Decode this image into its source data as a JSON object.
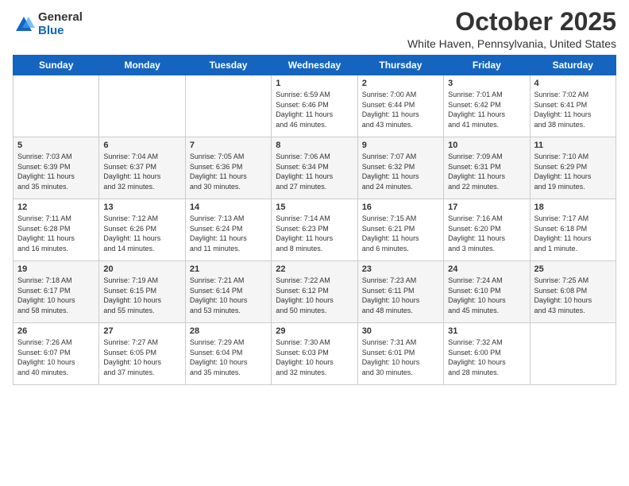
{
  "logo": {
    "general": "General",
    "blue": "Blue"
  },
  "header": {
    "month": "October 2025",
    "location": "White Haven, Pennsylvania, United States"
  },
  "weekdays": [
    "Sunday",
    "Monday",
    "Tuesday",
    "Wednesday",
    "Thursday",
    "Friday",
    "Saturday"
  ],
  "weeks": [
    [
      {
        "day": "",
        "info": ""
      },
      {
        "day": "",
        "info": ""
      },
      {
        "day": "",
        "info": ""
      },
      {
        "day": "1",
        "info": "Sunrise: 6:59 AM\nSunset: 6:46 PM\nDaylight: 11 hours\nand 46 minutes."
      },
      {
        "day": "2",
        "info": "Sunrise: 7:00 AM\nSunset: 6:44 PM\nDaylight: 11 hours\nand 43 minutes."
      },
      {
        "day": "3",
        "info": "Sunrise: 7:01 AM\nSunset: 6:42 PM\nDaylight: 11 hours\nand 41 minutes."
      },
      {
        "day": "4",
        "info": "Sunrise: 7:02 AM\nSunset: 6:41 PM\nDaylight: 11 hours\nand 38 minutes."
      }
    ],
    [
      {
        "day": "5",
        "info": "Sunrise: 7:03 AM\nSunset: 6:39 PM\nDaylight: 11 hours\nand 35 minutes."
      },
      {
        "day": "6",
        "info": "Sunrise: 7:04 AM\nSunset: 6:37 PM\nDaylight: 11 hours\nand 32 minutes."
      },
      {
        "day": "7",
        "info": "Sunrise: 7:05 AM\nSunset: 6:36 PM\nDaylight: 11 hours\nand 30 minutes."
      },
      {
        "day": "8",
        "info": "Sunrise: 7:06 AM\nSunset: 6:34 PM\nDaylight: 11 hours\nand 27 minutes."
      },
      {
        "day": "9",
        "info": "Sunrise: 7:07 AM\nSunset: 6:32 PM\nDaylight: 11 hours\nand 24 minutes."
      },
      {
        "day": "10",
        "info": "Sunrise: 7:09 AM\nSunset: 6:31 PM\nDaylight: 11 hours\nand 22 minutes."
      },
      {
        "day": "11",
        "info": "Sunrise: 7:10 AM\nSunset: 6:29 PM\nDaylight: 11 hours\nand 19 minutes."
      }
    ],
    [
      {
        "day": "12",
        "info": "Sunrise: 7:11 AM\nSunset: 6:28 PM\nDaylight: 11 hours\nand 16 minutes."
      },
      {
        "day": "13",
        "info": "Sunrise: 7:12 AM\nSunset: 6:26 PM\nDaylight: 11 hours\nand 14 minutes."
      },
      {
        "day": "14",
        "info": "Sunrise: 7:13 AM\nSunset: 6:24 PM\nDaylight: 11 hours\nand 11 minutes."
      },
      {
        "day": "15",
        "info": "Sunrise: 7:14 AM\nSunset: 6:23 PM\nDaylight: 11 hours\nand 8 minutes."
      },
      {
        "day": "16",
        "info": "Sunrise: 7:15 AM\nSunset: 6:21 PM\nDaylight: 11 hours\nand 6 minutes."
      },
      {
        "day": "17",
        "info": "Sunrise: 7:16 AM\nSunset: 6:20 PM\nDaylight: 11 hours\nand 3 minutes."
      },
      {
        "day": "18",
        "info": "Sunrise: 7:17 AM\nSunset: 6:18 PM\nDaylight: 11 hours\nand 1 minute."
      }
    ],
    [
      {
        "day": "19",
        "info": "Sunrise: 7:18 AM\nSunset: 6:17 PM\nDaylight: 10 hours\nand 58 minutes."
      },
      {
        "day": "20",
        "info": "Sunrise: 7:19 AM\nSunset: 6:15 PM\nDaylight: 10 hours\nand 55 minutes."
      },
      {
        "day": "21",
        "info": "Sunrise: 7:21 AM\nSunset: 6:14 PM\nDaylight: 10 hours\nand 53 minutes."
      },
      {
        "day": "22",
        "info": "Sunrise: 7:22 AM\nSunset: 6:12 PM\nDaylight: 10 hours\nand 50 minutes."
      },
      {
        "day": "23",
        "info": "Sunrise: 7:23 AM\nSunset: 6:11 PM\nDaylight: 10 hours\nand 48 minutes."
      },
      {
        "day": "24",
        "info": "Sunrise: 7:24 AM\nSunset: 6:10 PM\nDaylight: 10 hours\nand 45 minutes."
      },
      {
        "day": "25",
        "info": "Sunrise: 7:25 AM\nSunset: 6:08 PM\nDaylight: 10 hours\nand 43 minutes."
      }
    ],
    [
      {
        "day": "26",
        "info": "Sunrise: 7:26 AM\nSunset: 6:07 PM\nDaylight: 10 hours\nand 40 minutes."
      },
      {
        "day": "27",
        "info": "Sunrise: 7:27 AM\nSunset: 6:05 PM\nDaylight: 10 hours\nand 37 minutes."
      },
      {
        "day": "28",
        "info": "Sunrise: 7:29 AM\nSunset: 6:04 PM\nDaylight: 10 hours\nand 35 minutes."
      },
      {
        "day": "29",
        "info": "Sunrise: 7:30 AM\nSunset: 6:03 PM\nDaylight: 10 hours\nand 32 minutes."
      },
      {
        "day": "30",
        "info": "Sunrise: 7:31 AM\nSunset: 6:01 PM\nDaylight: 10 hours\nand 30 minutes."
      },
      {
        "day": "31",
        "info": "Sunrise: 7:32 AM\nSunset: 6:00 PM\nDaylight: 10 hours\nand 28 minutes."
      },
      {
        "day": "",
        "info": ""
      }
    ]
  ]
}
